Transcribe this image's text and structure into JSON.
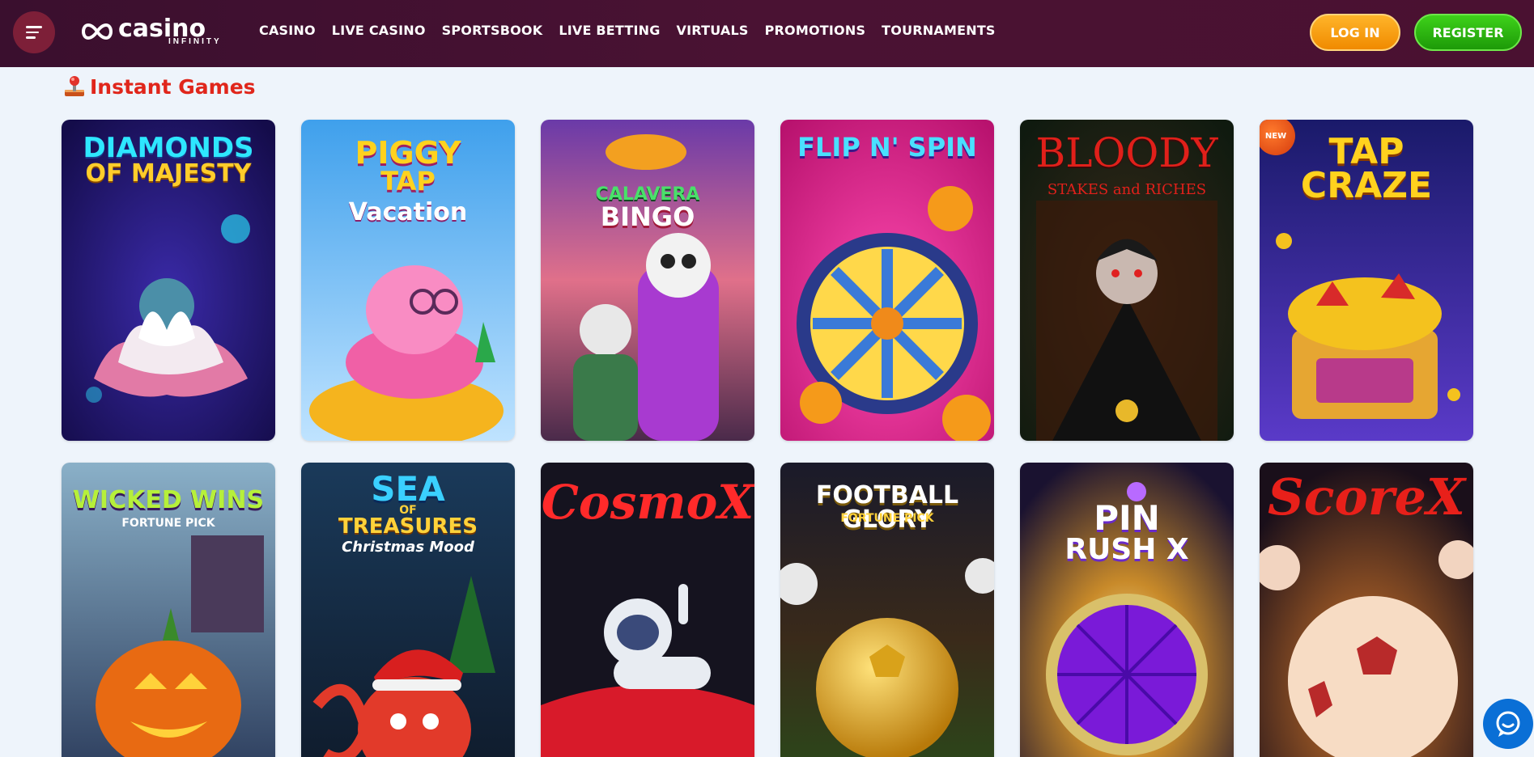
{
  "header": {
    "logo": {
      "primary": "casino",
      "secondary": "INFINITY"
    },
    "nav": [
      "CASINO",
      "LIVE CASINO",
      "SPORTSBOOK",
      "LIVE BETTING",
      "VIRTUALS",
      "PROMOTIONS",
      "TOURNAMENTS"
    ],
    "login_label": "LOG IN",
    "register_label": "REGISTER"
  },
  "section": {
    "title": "Instant Games"
  },
  "games": [
    {
      "title_lines": [
        "DIAMONDS",
        "OF MAJESTY"
      ],
      "badge": ""
    },
    {
      "title_lines": [
        "PIGGY",
        "TAP",
        "Vacation"
      ],
      "badge": ""
    },
    {
      "title_lines": [
        "CALAVERA",
        "BINGO"
      ],
      "badge": ""
    },
    {
      "title_lines": [
        "FLIP N' SPIN"
      ],
      "badge": ""
    },
    {
      "title_lines": [
        "BLOODY",
        "STAKES and RICHES"
      ],
      "badge": ""
    },
    {
      "title_lines": [
        "TAP",
        "CRAZE"
      ],
      "badge": "NEW"
    },
    {
      "title_lines": [
        "WICKED WINS",
        "FORTUNE PICK"
      ],
      "badge": ""
    },
    {
      "title_lines": [
        "SEA",
        "OF",
        "TREASURES",
        "Christmas Mood"
      ],
      "badge": ""
    },
    {
      "title_lines": [
        "CosmoX"
      ],
      "badge": ""
    },
    {
      "title_lines": [
        "FOOTBALL GLORY",
        "FORTUNE PICK"
      ],
      "badge": ""
    },
    {
      "title_lines": [
        "PIN",
        "RUSH X"
      ],
      "badge": ""
    },
    {
      "title_lines": [
        "ScoreX"
      ],
      "badge": ""
    }
  ],
  "icons": {
    "menu": "hamburger-icon",
    "logo_mark": "infinity-icon",
    "section": "joystick-icon",
    "chat": "chat-bubble-icon"
  },
  "colors": {
    "header_bg": "#4a1233",
    "accent_red": "#e0261b",
    "login": "#f5a00f",
    "register": "#2eb812",
    "page_bg": "#eef4fb"
  }
}
